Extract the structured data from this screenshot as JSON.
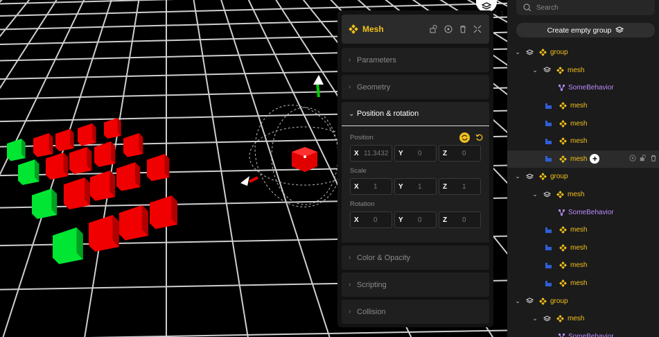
{
  "inspector": {
    "title": "Mesh",
    "sections": {
      "parameters": "Parameters",
      "geometry": "Geometry",
      "position_rotation": "Position & rotation",
      "color_opacity": "Color & Opacity",
      "scripting": "Scripting",
      "collision": "Collision"
    },
    "position": {
      "label": "Position",
      "x": "11.3432",
      "y": "0",
      "z": "0"
    },
    "scale": {
      "label": "Scale",
      "x": "1",
      "y": "1",
      "z": "1"
    },
    "rotation": {
      "label": "Rotation",
      "x": "0",
      "y": "0",
      "z": "0"
    },
    "axes": {
      "x": "X",
      "y": "Y",
      "z": "Z"
    }
  },
  "outliner": {
    "search_placeholder": "Search",
    "create_group_label": "Create empty group",
    "tree": [
      {
        "type": "group",
        "label": "group"
      },
      {
        "type": "group-mesh",
        "label": "mesh"
      },
      {
        "type": "behavior",
        "label": "SomeBehavior"
      },
      {
        "type": "mesh",
        "label": "mesh"
      },
      {
        "type": "mesh",
        "label": "mesh"
      },
      {
        "type": "mesh",
        "label": "mesh"
      },
      {
        "type": "mesh",
        "label": "mesh",
        "selected": true
      },
      {
        "type": "group",
        "label": "group"
      },
      {
        "type": "group-mesh",
        "label": "mesh"
      },
      {
        "type": "behavior",
        "label": "SomeBehavior"
      },
      {
        "type": "mesh",
        "label": "mesh"
      },
      {
        "type": "mesh",
        "label": "mesh"
      },
      {
        "type": "mesh",
        "label": "mesh"
      },
      {
        "type": "mesh",
        "label": "mesh"
      },
      {
        "type": "group",
        "label": "group"
      },
      {
        "type": "group-mesh",
        "label": "mesh"
      },
      {
        "type": "behavior",
        "label": "SomeBehavior"
      }
    ]
  },
  "colors": {
    "accent": "#f2c01c",
    "behavior": "#b98bff",
    "mesh_icon": "#2f5fd6",
    "cube_red": "#ff0000",
    "cube_green": "#00e632"
  },
  "icons": {
    "layers": "layers-icon",
    "search": "search-icon",
    "mesh": "mesh-icon",
    "lock": "lock-icon",
    "target": "target-icon",
    "trash": "trash-icon",
    "collapse": "collapse-icon",
    "sync": "sync-icon",
    "reset": "reset-icon"
  }
}
